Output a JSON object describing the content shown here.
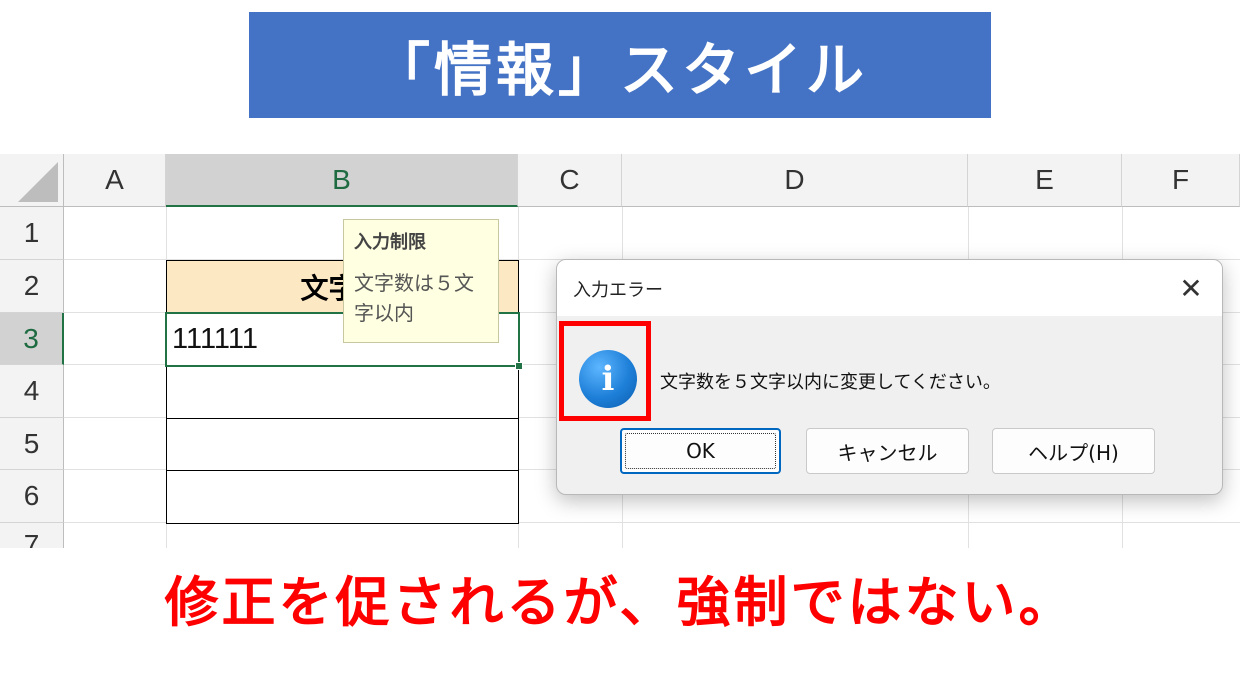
{
  "banner": {
    "title": "「情報」スタイル"
  },
  "spreadsheet": {
    "columns": [
      "A",
      "B",
      "C",
      "D",
      "E",
      "F"
    ],
    "rows": [
      "1",
      "2",
      "3",
      "4",
      "5",
      "6",
      "7"
    ],
    "cells": {
      "B2": "文字列",
      "B3": "111111"
    }
  },
  "input_tooltip": {
    "title": "入力制限",
    "body": "文字数は５文字以内"
  },
  "dialog": {
    "title": "入力エラー",
    "close_symbol": "✕",
    "icon": "information-icon",
    "message": "文字数を５文字以内に変更してください。",
    "buttons": {
      "ok": "OK",
      "cancel": "キャンセル",
      "help": "ヘルプ(H)"
    }
  },
  "caption": "修正を促されるが、強制ではない。",
  "colors": {
    "banner": "#4472c4",
    "header_cell": "#fde8c4",
    "highlight": "#ff0000",
    "selection": "#217346"
  }
}
